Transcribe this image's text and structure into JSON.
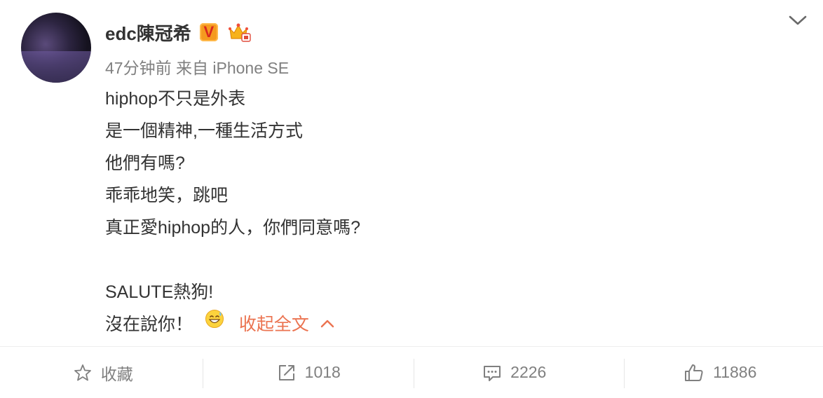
{
  "post": {
    "username": "edc陳冠希",
    "vip_badge": "V",
    "meta": "47分钟前 来自 iPhone SE",
    "lines": [
      "hiphop不只是外表",
      "是一個精神,一種生活方式",
      "他們有嗎?",
      "乖乖地笑，跳吧",
      "真正愛hiphop的人，你們同意嗎?",
      "",
      "SALUTE熱狗!",
      "沒在說你！"
    ],
    "collapse_label": "收起全文"
  },
  "actions": {
    "favorite_label": "收藏",
    "repost_count": "1018",
    "comment_count": "2226",
    "like_count": "11886"
  },
  "colors": {
    "accent": "#eb7350",
    "muted": "#808080",
    "text": "#333333"
  }
}
